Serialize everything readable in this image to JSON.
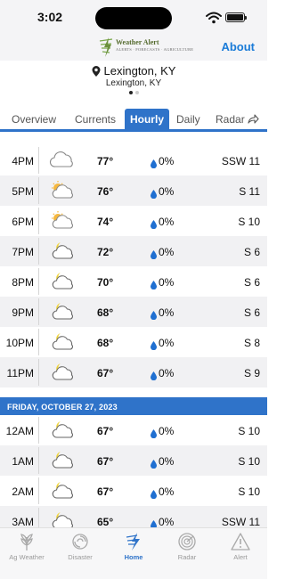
{
  "status": {
    "time": "3:02"
  },
  "header": {
    "logo_title": "Weather Alert",
    "logo_subtitle": "ALERTS · FORECASTS · AGRICULTURE",
    "about_label": "About"
  },
  "location": {
    "name": "Lexington, KY",
    "subtitle": "Lexington, KY"
  },
  "tabs": [
    {
      "label": "Overview"
    },
    {
      "label": "Currents"
    },
    {
      "label": "Hourly"
    },
    {
      "label": "Daily"
    },
    {
      "label": "Radar"
    }
  ],
  "active_tab": "Hourly",
  "hours_day1": [
    {
      "time": "4PM",
      "icon": "cloudy-icon",
      "temp": "77°",
      "precip": "0%",
      "wind": "SSW 11"
    },
    {
      "time": "5PM",
      "icon": "partly-sunny-icon",
      "temp": "76°",
      "precip": "0%",
      "wind": "S 11"
    },
    {
      "time": "6PM",
      "icon": "partly-sunny-icon",
      "temp": "74°",
      "precip": "0%",
      "wind": "S 10"
    },
    {
      "time": "7PM",
      "icon": "partly-cloudy-night-icon",
      "temp": "72°",
      "precip": "0%",
      "wind": "S 6"
    },
    {
      "time": "8PM",
      "icon": "partly-cloudy-night-icon",
      "temp": "70°",
      "precip": "0%",
      "wind": "S 6"
    },
    {
      "time": "9PM",
      "icon": "partly-cloudy-night-icon",
      "temp": "68°",
      "precip": "0%",
      "wind": "S 6"
    },
    {
      "time": "10PM",
      "icon": "partly-cloudy-night-icon",
      "temp": "68°",
      "precip": "0%",
      "wind": "S 8"
    },
    {
      "time": "11PM",
      "icon": "partly-cloudy-night-icon",
      "temp": "67°",
      "precip": "0%",
      "wind": "S 9"
    }
  ],
  "date_header": "FRIDAY, OCTOBER 27, 2023",
  "hours_day2": [
    {
      "time": "12AM",
      "icon": "partly-cloudy-night-icon",
      "temp": "67°",
      "precip": "0%",
      "wind": "S 10"
    },
    {
      "time": "1AM",
      "icon": "partly-cloudy-night-icon",
      "temp": "67°",
      "precip": "0%",
      "wind": "S 10"
    },
    {
      "time": "2AM",
      "icon": "partly-cloudy-night-icon",
      "temp": "67°",
      "precip": "0%",
      "wind": "S 10"
    },
    {
      "time": "3AM",
      "icon": "partly-cloudy-night-icon",
      "temp": "65°",
      "precip": "0%",
      "wind": "SSW 11"
    }
  ],
  "bottom_nav": [
    {
      "label": "Ag Weather",
      "icon": "wheat-icon"
    },
    {
      "label": "Disaster",
      "icon": "disaster-icon"
    },
    {
      "label": "Home",
      "icon": "home-bolt-icon"
    },
    {
      "label": "Radar",
      "icon": "radar-icon"
    },
    {
      "label": "Alert",
      "icon": "alert-triangle-icon"
    }
  ],
  "active_nav": "Home",
  "colors": {
    "accent": "#2f73c9",
    "about": "#1a7bd8",
    "alt_row": "#f1f1f3",
    "drop": "#1f6fd1"
  }
}
